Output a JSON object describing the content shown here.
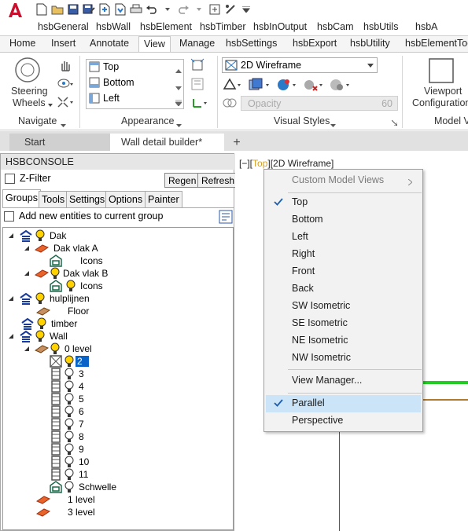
{
  "app": {
    "accent": "#c8102e"
  },
  "menu": [
    "hsbGeneral",
    "hsbWall",
    "hsbElement",
    "hsbTimber",
    "hsbInOutput",
    "hsbCam",
    "hsbUtils",
    "hsbA"
  ],
  "ribbon_tabs": [
    "Home",
    "Insert",
    "Annotate",
    "View",
    "Manage",
    "hsbSettings",
    "hsbExport",
    "hsbUtility",
    "hsbElementToo"
  ],
  "active_ribbon_tab": "View",
  "navigate": {
    "steering_label_1": "Steering",
    "steering_label_2": "Wheels",
    "panel_title": "Navigate"
  },
  "appearance": {
    "views": [
      "Top",
      "Bottom",
      "Left"
    ],
    "panel_title": "Appearance"
  },
  "visual_styles": {
    "current": "2D Wireframe",
    "opacity_label": "Opacity",
    "opacity_value": "60",
    "panel_title": "Visual Styles"
  },
  "model_viewports": {
    "viewport_label_1": "Viewport",
    "viewport_label_2": "Configuration",
    "panel_title": "Model V"
  },
  "doc_tabs": [
    "Start",
    "Wall detail builder*"
  ],
  "console": {
    "title": "HSBCONSOLE",
    "zfilter_label": "Z-Filter",
    "regen_label": "Regen",
    "refresh_label": "Refresh",
    "tabs": [
      "Groups",
      "Tools",
      "Settings",
      "Options",
      "Painter"
    ],
    "add_entities_label": "Add new entities to current group",
    "tree": [
      {
        "label": "Dak"
      },
      {
        "label": "Dak vlak A"
      },
      {
        "label": "Icons"
      },
      {
        "label": "Dak vlak B"
      },
      {
        "label": "Icons"
      },
      {
        "label": "hulplijnen"
      },
      {
        "label": "Floor"
      },
      {
        "label": "timber"
      },
      {
        "label": "Wall"
      },
      {
        "label": "0 level"
      },
      {
        "label": "2"
      },
      {
        "label": "3"
      },
      {
        "label": "4"
      },
      {
        "label": "5"
      },
      {
        "label": "6"
      },
      {
        "label": "7"
      },
      {
        "label": "8"
      },
      {
        "label": "9"
      },
      {
        "label": "10"
      },
      {
        "label": "11"
      },
      {
        "label": "Schwelle"
      },
      {
        "label": "1 level"
      },
      {
        "label": "3 level"
      }
    ]
  },
  "viewport": {
    "label_open": "[−][",
    "label_view": "Top",
    "label_close": "][2D Wireframe]"
  },
  "view_menu": {
    "custom_label": "Custom Model Views",
    "items": [
      "Top",
      "Bottom",
      "Left",
      "Right",
      "Front",
      "Back",
      "SW Isometric",
      "SE Isometric",
      "NE Isometric",
      "NW Isometric"
    ],
    "checked_view": "Top",
    "view_manager": "View Manager...",
    "projections": [
      "Parallel",
      "Perspective"
    ],
    "checked_projection": "Parallel"
  }
}
